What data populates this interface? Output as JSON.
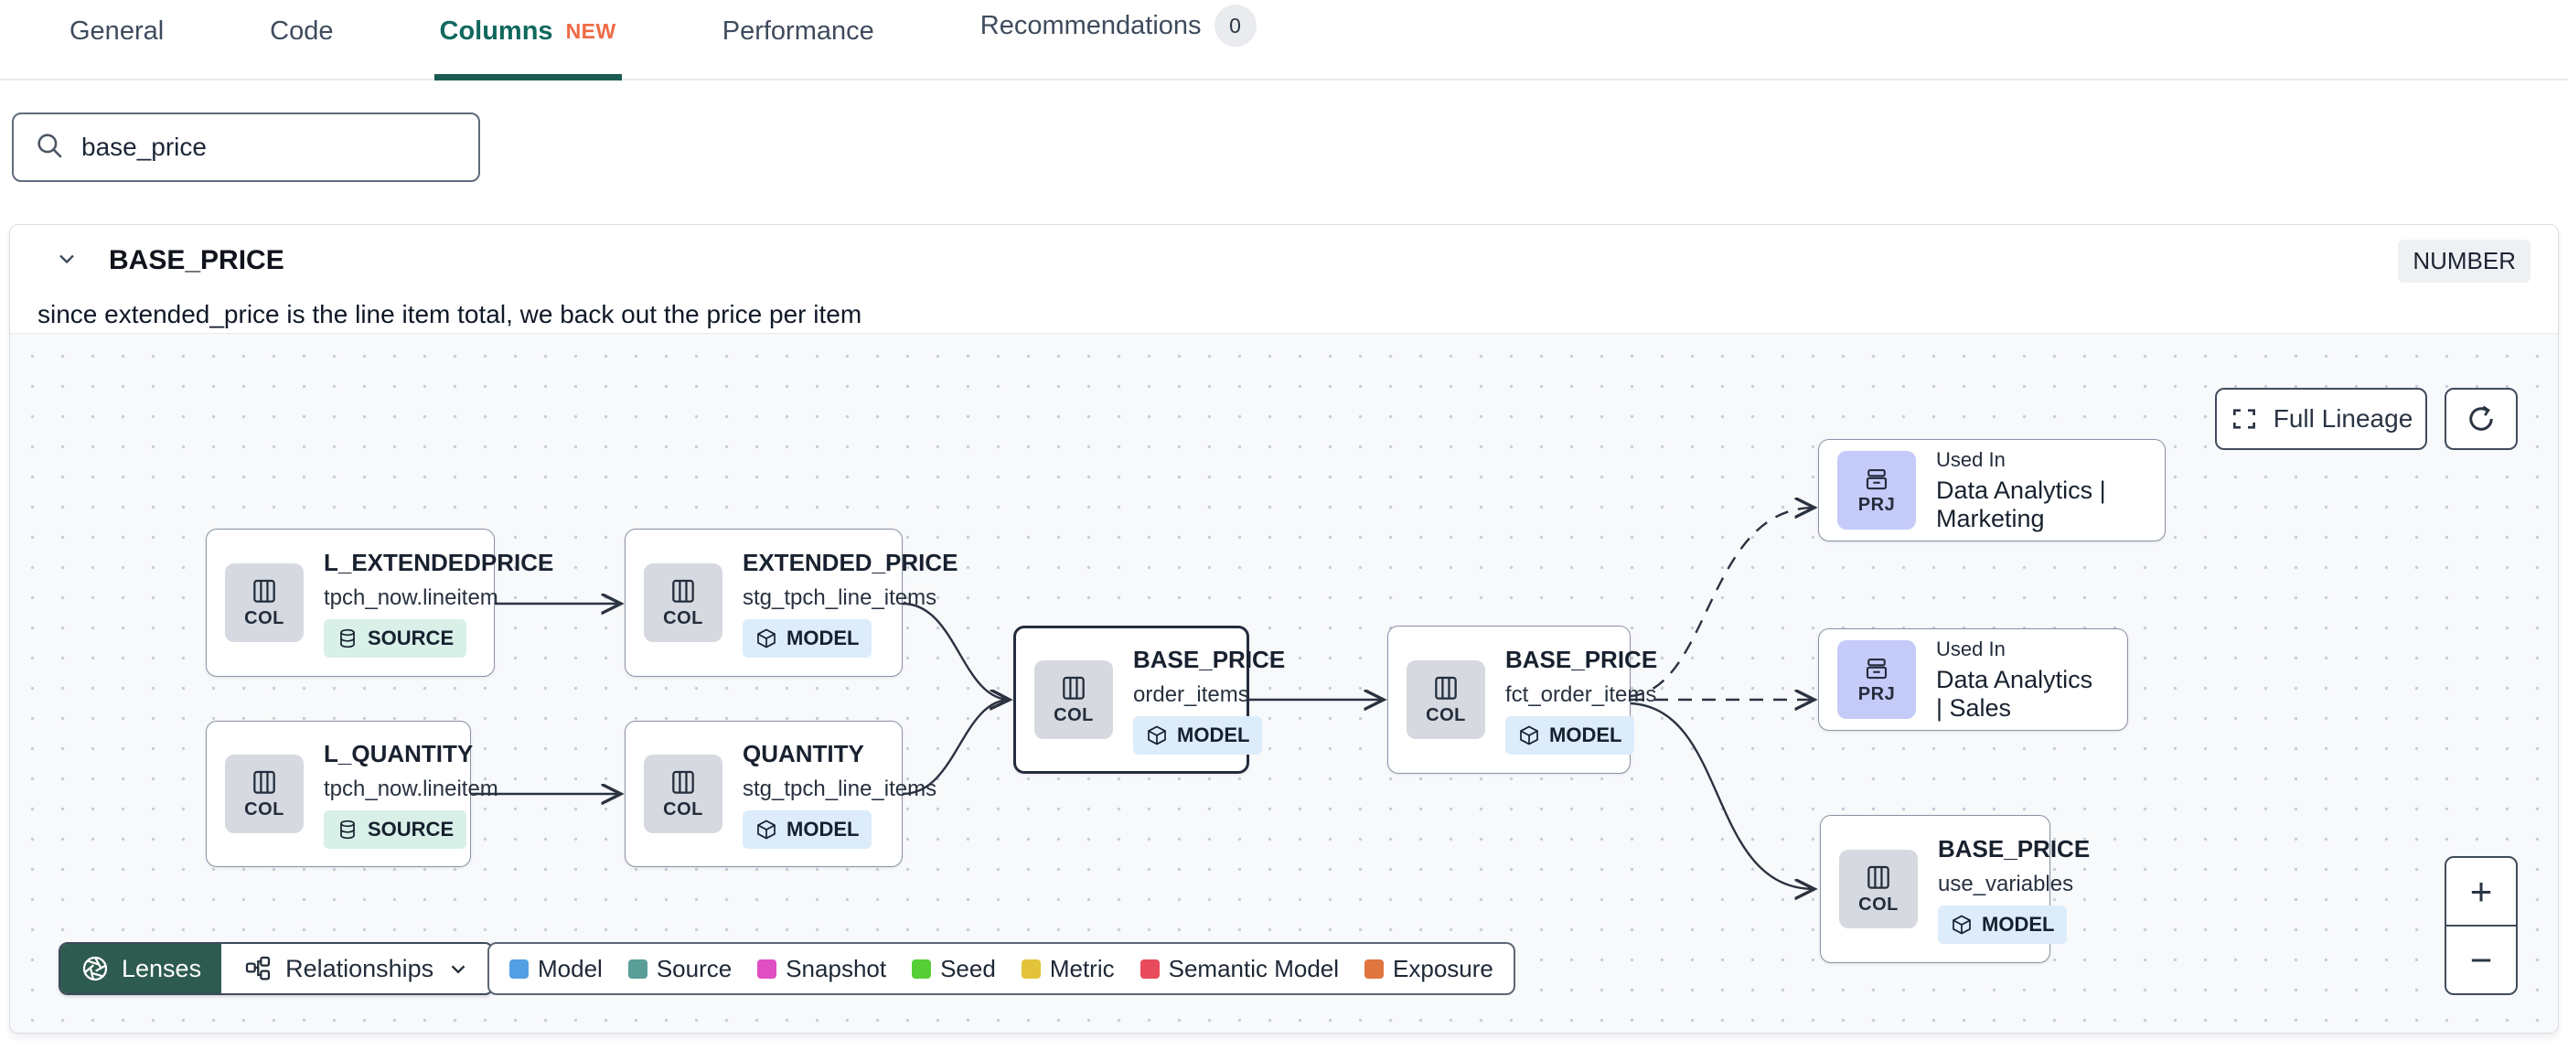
{
  "tabs": {
    "items": [
      {
        "label": "General"
      },
      {
        "label": "Code"
      },
      {
        "label": "Columns",
        "badge": "NEW"
      },
      {
        "label": "Performance"
      },
      {
        "label": "Recommendations",
        "count": "0"
      }
    ]
  },
  "search": {
    "value": "base_price"
  },
  "column_panel": {
    "title": "BASE_PRICE",
    "type": "NUMBER",
    "description": "since extended_price is the line item total, we back out the price per item"
  },
  "lineage": {
    "toolbar": {
      "lenses": "Lenses",
      "relationships": "Relationships"
    },
    "controls": {
      "full_lineage": "Full Lineage",
      "zoom_in": "+",
      "zoom_out": "−"
    },
    "legend": [
      {
        "label": "Model",
        "color": "#549fe3"
      },
      {
        "label": "Source",
        "color": "#5b9e98"
      },
      {
        "label": "Snapshot",
        "color": "#e04ec4"
      },
      {
        "label": "Seed",
        "color": "#55cf35"
      },
      {
        "label": "Metric",
        "color": "#e3c33b"
      },
      {
        "label": "Semantic Model",
        "color": "#e84b5c"
      },
      {
        "label": "Exposure",
        "color": "#e0763f"
      }
    ],
    "nodes": [
      {
        "kind": "COL",
        "title": "L_EXTENDEDPRICE",
        "subtitle": "tpch_now.lineitem",
        "badge": "SOURCE"
      },
      {
        "kind": "COL",
        "title": "EXTENDED_PRICE",
        "subtitle": "stg_tpch_line_items",
        "badge": "MODEL"
      },
      {
        "kind": "COL",
        "title": "L_QUANTITY",
        "subtitle": "tpch_now.lineitem",
        "badge": "SOURCE"
      },
      {
        "kind": "COL",
        "title": "QUANTITY",
        "subtitle": "stg_tpch_line_items",
        "badge": "MODEL"
      },
      {
        "kind": "COL",
        "title": "BASE_PRICE",
        "subtitle": "order_items",
        "badge": "MODEL"
      },
      {
        "kind": "COL",
        "title": "BASE_PRICE",
        "subtitle": "fct_order_items",
        "badge": "MODEL"
      },
      {
        "kind": "PRJ",
        "used_in": "Used In",
        "name": "Data Analytics | Marketing"
      },
      {
        "kind": "PRJ",
        "used_in": "Used In",
        "name": "Data Analytics | Sales"
      },
      {
        "kind": "COL",
        "title": "BASE_PRICE",
        "subtitle": "use_variables",
        "badge": "MODEL"
      }
    ]
  }
}
